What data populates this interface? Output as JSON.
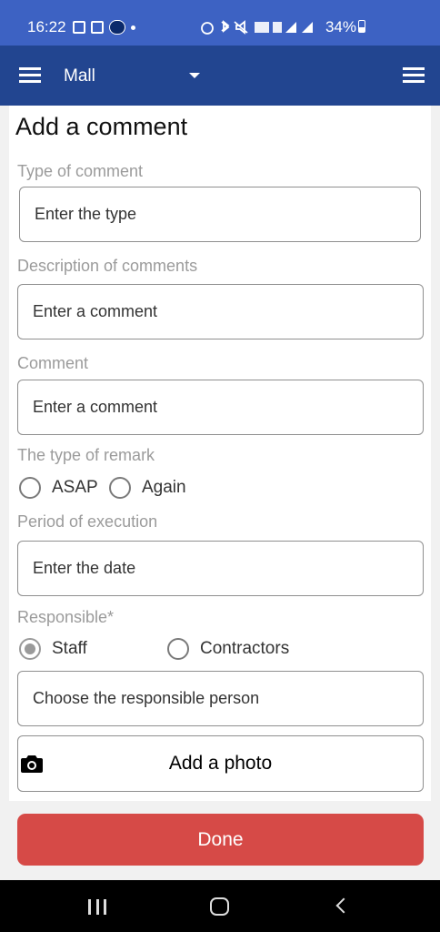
{
  "status_bar": {
    "time": "16:22",
    "battery": "34%",
    "icons": [
      "image-icon",
      "notification-icon",
      "app-icon",
      "alarm-icon",
      "bluetooth-icon",
      "mute-icon",
      "volte-icon",
      "4g-icon",
      "signal-icon",
      "signal-icon",
      "battery-icon"
    ]
  },
  "app_bar": {
    "title": "Mall",
    "background": "#224590"
  },
  "form": {
    "title": "Add a comment",
    "type_of_comment": {
      "label": "Type of comment",
      "placeholder": "Enter the type"
    },
    "description": {
      "label": "Description of comments",
      "placeholder": "Enter a comment"
    },
    "comment": {
      "label": "Comment",
      "placeholder": "Enter a comment"
    },
    "remark_type": {
      "label": "The type of remark",
      "options": [
        {
          "label": "ASAP",
          "selected": false
        },
        {
          "label": "Again",
          "selected": false
        }
      ]
    },
    "period": {
      "label": "Period of execution",
      "placeholder": "Enter the date"
    },
    "responsible": {
      "label": "Responsible*",
      "options": [
        {
          "label": "Staff",
          "selected": true
        },
        {
          "label": "Contractors",
          "selected": false
        }
      ],
      "placeholder": "Choose the responsible person"
    },
    "photo_button": "Add a photo",
    "done_button": "Done",
    "done_color": "#d64a47"
  }
}
